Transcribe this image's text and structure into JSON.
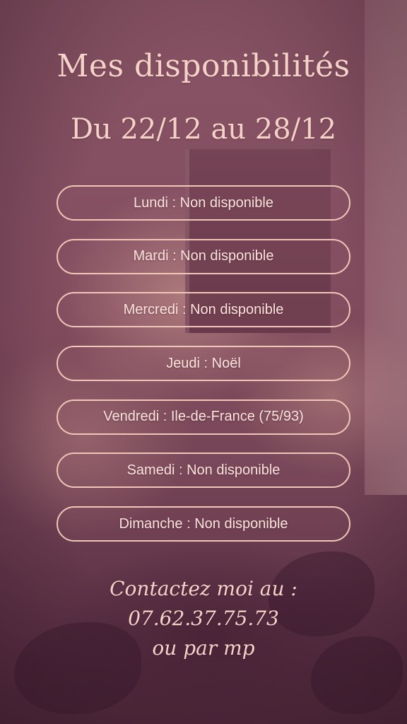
{
  "title": "Mes disponibilités",
  "subtitle": "Du 22/12 au 28/12",
  "days": [
    {
      "label": "Lundi : Non disponible"
    },
    {
      "label": "Mardi : Non disponible"
    },
    {
      "label": "Mercredi : Non disponible"
    },
    {
      "label": "Jeudi : Noël"
    },
    {
      "label": "Vendredi : Ile-de-France (75/93)"
    },
    {
      "label": "Samedi : Non disponible"
    },
    {
      "label": "Dimanche : Non disponible"
    }
  ],
  "contact": {
    "line1": "Contactez moi au :",
    "phone": "07.62.37.75.73",
    "line3": "ou par mp"
  },
  "colors": {
    "text": "#f4d2c8",
    "pill_border": "#f0c6b8",
    "background": "#7e4a5c"
  }
}
